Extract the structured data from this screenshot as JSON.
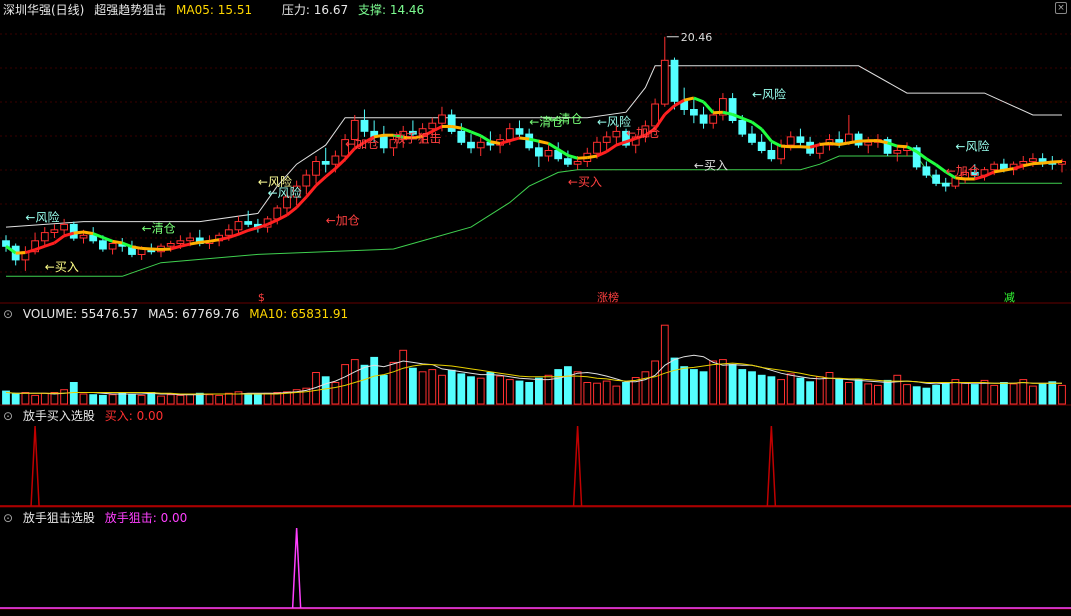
{
  "main_header": {
    "stock": "深圳华强(日线)",
    "indicator": "超强趋势狙击",
    "ma_label": "MA05: 15.51",
    "pressure_label": "压力: 16.67",
    "support_label": "支撑: 14.46"
  },
  "volume_header": {
    "name": "VOLUME: 55476.57",
    "ma5": "MA5: 67769.76",
    "ma10": "MA10: 65831.91"
  },
  "buy_header": {
    "name": "放手买入选股",
    "value": "买入: 0.00"
  },
  "snipe_header": {
    "name": "放手狙击选股",
    "value": "放手狙击: 0.00"
  },
  "colors": {
    "up": "#ff3030",
    "down": "#54ffff",
    "pressure": "#e0e0e0",
    "support": "#3fd04f",
    "buy_signal": "#c00000",
    "snipe_signal": "#ff40ff",
    "ma5": "#e0e0e0",
    "ma10": "#e8d000"
  },
  "chart_data": [
    {
      "type": "candlestick",
      "title": "超强趋势狙击",
      "peak_label": "20.46",
      "candles": [
        [
          13.0,
          13.2,
          12.6,
          12.8
        ],
        [
          12.8,
          12.9,
          12.1,
          12.3
        ],
        [
          12.3,
          12.8,
          11.9,
          12.6
        ],
        [
          12.6,
          13.3,
          12.5,
          13.0
        ],
        [
          13.0,
          13.5,
          12.8,
          13.3
        ],
        [
          13.3,
          13.6,
          13.1,
          13.4
        ],
        [
          13.4,
          13.8,
          13.2,
          13.6
        ],
        [
          13.6,
          13.7,
          13.0,
          13.1
        ],
        [
          13.1,
          13.4,
          12.9,
          13.2
        ],
        [
          13.2,
          13.5,
          12.9,
          13.0
        ],
        [
          13.0,
          13.2,
          12.6,
          12.7
        ],
        [
          12.7,
          13.0,
          12.5,
          12.9
        ],
        [
          12.9,
          13.1,
          12.6,
          12.8
        ],
        [
          12.8,
          13.0,
          12.4,
          12.5
        ],
        [
          12.5,
          12.8,
          12.3,
          12.7
        ],
        [
          12.7,
          12.9,
          12.5,
          12.6
        ],
        [
          12.6,
          12.9,
          12.4,
          12.8
        ],
        [
          12.8,
          13.0,
          12.6,
          12.9
        ],
        [
          12.9,
          13.2,
          12.7,
          13.0
        ],
        [
          13.0,
          13.3,
          12.8,
          13.1
        ],
        [
          13.1,
          13.4,
          12.8,
          12.9
        ],
        [
          12.9,
          13.2,
          12.7,
          13.0
        ],
        [
          13.0,
          13.3,
          12.8,
          13.2
        ],
        [
          13.2,
          13.6,
          13.0,
          13.4
        ],
        [
          13.4,
          13.9,
          13.2,
          13.7
        ],
        [
          13.7,
          14.1,
          13.5,
          13.6
        ],
        [
          13.6,
          13.8,
          13.3,
          13.5
        ],
        [
          13.5,
          13.9,
          13.3,
          13.8
        ],
        [
          13.8,
          14.3,
          13.6,
          14.2
        ],
        [
          14.2,
          14.8,
          14.0,
          14.6
        ],
        [
          14.6,
          15.2,
          14.3,
          15.0
        ],
        [
          15.0,
          15.6,
          14.7,
          15.4
        ],
        [
          15.4,
          16.1,
          15.1,
          15.9
        ],
        [
          15.9,
          16.4,
          15.5,
          15.8
        ],
        [
          15.8,
          16.3,
          15.5,
          16.1
        ],
        [
          16.1,
          16.9,
          15.9,
          16.7
        ],
        [
          16.7,
          17.6,
          16.4,
          17.4
        ],
        [
          17.4,
          17.8,
          16.8,
          17.0
        ],
        [
          17.0,
          17.4,
          16.6,
          16.8
        ],
        [
          16.8,
          17.2,
          16.2,
          16.4
        ],
        [
          16.4,
          16.9,
          16.1,
          16.7
        ],
        [
          16.7,
          17.2,
          16.4,
          17.0
        ],
        [
          17.0,
          17.4,
          16.7,
          16.9
        ],
        [
          16.9,
          17.3,
          16.6,
          17.1
        ],
        [
          17.1,
          17.5,
          16.8,
          17.3
        ],
        [
          17.3,
          17.9,
          17.0,
          17.6
        ],
        [
          17.6,
          17.8,
          16.9,
          17.0
        ],
        [
          17.0,
          17.3,
          16.5,
          16.6
        ],
        [
          16.6,
          16.9,
          16.2,
          16.4
        ],
        [
          16.4,
          16.8,
          16.1,
          16.6
        ],
        [
          16.6,
          17.0,
          16.3,
          16.5
        ],
        [
          16.5,
          16.9,
          16.2,
          16.7
        ],
        [
          16.7,
          17.3,
          16.5,
          17.1
        ],
        [
          17.1,
          17.4,
          16.8,
          16.9
        ],
        [
          16.9,
          17.1,
          16.3,
          16.4
        ],
        [
          16.4,
          16.7,
          15.7,
          16.1
        ],
        [
          16.1,
          16.5,
          15.9,
          16.3
        ],
        [
          16.3,
          16.6,
          15.9,
          16.0
        ],
        [
          16.0,
          16.3,
          15.7,
          15.8
        ],
        [
          15.8,
          16.1,
          15.6,
          15.9
        ],
        [
          15.9,
          16.4,
          15.7,
          16.2
        ],
        [
          16.2,
          16.8,
          16.0,
          16.6
        ],
        [
          16.6,
          17.0,
          16.3,
          16.8
        ],
        [
          16.8,
          17.2,
          16.5,
          17.0
        ],
        [
          17.0,
          17.1,
          16.4,
          16.5
        ],
        [
          16.5,
          16.9,
          16.2,
          16.8
        ],
        [
          16.8,
          17.4,
          16.6,
          17.2
        ],
        [
          17.2,
          18.2,
          17.0,
          18.0
        ],
        [
          18.0,
          20.46,
          17.9,
          19.6
        ],
        [
          19.6,
          19.7,
          17.8,
          18.1
        ],
        [
          18.1,
          18.6,
          17.6,
          17.8
        ],
        [
          17.8,
          18.2,
          17.3,
          17.6
        ],
        [
          17.6,
          17.9,
          17.1,
          17.3
        ],
        [
          17.3,
          17.8,
          17.1,
          17.6
        ],
        [
          17.6,
          18.4,
          17.4,
          18.2
        ],
        [
          18.2,
          18.4,
          17.3,
          17.4
        ],
        [
          17.4,
          17.6,
          16.8,
          16.9
        ],
        [
          16.9,
          17.2,
          16.5,
          16.6
        ],
        [
          16.6,
          16.9,
          16.2,
          16.3
        ],
        [
          16.3,
          16.6,
          15.9,
          16.0
        ],
        [
          16.0,
          16.7,
          15.8,
          16.5
        ],
        [
          16.5,
          17.0,
          16.3,
          16.8
        ],
        [
          16.8,
          17.1,
          16.4,
          16.6
        ],
        [
          16.6,
          16.8,
          16.1,
          16.2
        ],
        [
          16.2,
          16.6,
          16.0,
          16.5
        ],
        [
          16.5,
          16.9,
          16.3,
          16.7
        ],
        [
          16.7,
          17.0,
          16.4,
          16.6
        ],
        [
          16.6,
          17.6,
          16.5,
          16.9
        ],
        [
          16.9,
          17.0,
          16.4,
          16.5
        ],
        [
          16.5,
          16.8,
          16.2,
          16.6
        ],
        [
          16.6,
          16.9,
          16.4,
          16.7
        ],
        [
          16.7,
          16.8,
          16.1,
          16.2
        ],
        [
          16.2,
          16.5,
          15.9,
          16.3
        ],
        [
          16.3,
          16.6,
          16.1,
          16.4
        ],
        [
          16.4,
          16.5,
          15.6,
          15.7
        ],
        [
          15.7,
          15.9,
          15.3,
          15.4
        ],
        [
          15.4,
          15.6,
          15.0,
          15.1
        ],
        [
          15.1,
          15.3,
          14.8,
          15.0
        ],
        [
          15.0,
          15.4,
          14.9,
          15.3
        ],
        [
          15.3,
          15.6,
          15.1,
          15.5
        ],
        [
          15.5,
          15.8,
          15.3,
          15.4
        ],
        [
          15.4,
          15.7,
          15.2,
          15.6
        ],
        [
          15.6,
          15.9,
          15.4,
          15.8
        ],
        [
          15.8,
          16.0,
          15.5,
          15.6
        ],
        [
          15.6,
          15.9,
          15.4,
          15.8
        ],
        [
          15.8,
          16.1,
          15.6,
          15.9
        ],
        [
          15.9,
          16.2,
          15.7,
          16.0
        ],
        [
          16.0,
          16.2,
          15.7,
          15.9
        ],
        [
          15.9,
          16.1,
          15.6,
          15.8
        ],
        [
          15.8,
          16.0,
          15.5,
          15.9
        ]
      ],
      "pressure": [
        [
          0,
          13.5
        ],
        [
          8,
          13.7
        ],
        [
          20,
          13.7
        ],
        [
          26,
          14.0
        ],
        [
          28,
          15.0
        ],
        [
          30,
          15.8
        ],
        [
          33,
          16.5
        ],
        [
          35,
          17.5
        ],
        [
          45,
          17.5
        ],
        [
          60,
          17.5
        ],
        [
          64,
          17.7
        ],
        [
          66,
          18.6
        ],
        [
          67,
          19.4
        ],
        [
          88,
          19.4
        ],
        [
          93,
          18.4
        ],
        [
          101,
          18.4
        ],
        [
          106,
          17.6
        ],
        [
          109,
          17.6
        ]
      ],
      "support": [
        [
          0,
          11.7
        ],
        [
          12,
          11.7
        ],
        [
          16,
          12.2
        ],
        [
          26,
          12.5
        ],
        [
          40,
          12.7
        ],
        [
          44,
          13.1
        ],
        [
          48,
          13.5
        ],
        [
          52,
          14.4
        ],
        [
          54,
          15.0
        ],
        [
          57,
          15.5
        ],
        [
          59,
          15.6
        ],
        [
          75,
          15.6
        ],
        [
          82,
          15.6
        ],
        [
          84,
          15.8
        ],
        [
          86,
          16.1
        ],
        [
          94,
          16.1
        ],
        [
          96,
          15.1
        ],
        [
          109,
          15.1
        ]
      ],
      "labels": [
        "←风险",
        "←买入",
        "←加仓",
        "←清仓",
        "←风险",
        "←加仓",
        "←风险",
        "放手狙击",
        "←清仓",
        "←加仓",
        "←清仓",
        "←买入",
        "←风险",
        "←风险",
        "←买入",
        "←加仓",
        "←风险"
      ],
      "bottom_markers": [
        "$",
        "涨榜",
        "减"
      ]
    },
    {
      "type": "bar",
      "title": "VOLUME",
      "values": [
        18,
        14,
        16,
        12,
        15,
        16,
        20,
        30,
        14,
        13,
        12,
        13,
        15,
        14,
        12,
        16,
        11,
        13,
        12,
        14,
        15,
        13,
        12,
        15,
        17,
        14,
        13,
        15,
        16,
        17,
        20,
        22,
        44,
        38,
        30,
        55,
        62,
        54,
        65,
        40,
        58,
        75,
        50,
        45,
        48,
        40,
        47,
        42,
        38,
        36,
        44,
        39,
        34,
        32,
        30,
        36,
        40,
        48,
        52,
        45,
        30,
        29,
        32,
        25,
        30,
        37,
        45,
        60,
        110,
        64,
        52,
        48,
        45,
        60,
        62,
        55,
        48,
        45,
        40,
        38,
        34,
        42,
        36,
        31,
        38,
        44,
        35,
        30,
        34,
        28,
        26,
        33,
        40,
        27,
        24,
        22,
        26,
        30,
        34,
        29,
        27,
        33,
        26,
        30,
        28,
        34,
        25,
        28,
        31,
        26
      ],
      "ma5": [
        16,
        15,
        15,
        15,
        15,
        14,
        15,
        16,
        16,
        16,
        15,
        14,
        14,
        14,
        14,
        15,
        14,
        14,
        13,
        13,
        13,
        14,
        14,
        14,
        14,
        15,
        15,
        15,
        15,
        16,
        17,
        19,
        23,
        28,
        32,
        38,
        45,
        51,
        54,
        52,
        56,
        60,
        58,
        56,
        55,
        49,
        47,
        45,
        43,
        41,
        41,
        40,
        38,
        36,
        35,
        34,
        34,
        36,
        39,
        43,
        44,
        42,
        39,
        35,
        31,
        31,
        34,
        40,
        54,
        62,
        66,
        68,
        66,
        58,
        54,
        55,
        54,
        54,
        51,
        47,
        43,
        40,
        38,
        36,
        35,
        36,
        35,
        34,
        33,
        32,
        31,
        30,
        31,
        32,
        31,
        29,
        28,
        29,
        30,
        29,
        29,
        29,
        29,
        29,
        29,
        30,
        29,
        29,
        29,
        29
      ],
      "ma10": [
        16,
        15,
        15,
        15,
        15,
        15,
        15,
        16,
        16,
        16,
        16,
        16,
        16,
        16,
        16,
        16,
        15,
        15,
        14,
        14,
        14,
        14,
        14,
        14,
        14,
        14,
        14,
        14,
        14,
        15,
        16,
        17,
        19,
        21,
        23,
        26,
        30,
        34,
        39,
        41,
        45,
        50,
        53,
        55,
        55,
        54,
        53,
        51,
        49,
        47,
        45,
        43,
        41,
        39,
        38,
        38,
        38,
        38,
        39,
        39,
        38,
        36,
        35,
        33,
        32,
        33,
        36,
        38,
        43,
        47,
        50,
        51,
        53,
        55,
        56,
        57,
        56,
        54,
        51,
        49,
        47,
        45,
        43,
        40,
        38,
        36,
        36,
        35,
        35,
        34,
        33,
        32,
        32,
        32,
        31,
        30,
        30,
        30,
        30,
        30,
        30,
        30,
        29,
        29,
        29,
        30,
        29,
        29,
        29,
        29
      ],
      "ylim": [
        0,
        120
      ]
    },
    {
      "type": "line",
      "title": "放手买入选股",
      "name": "买入",
      "x": [
        0,
        1,
        2,
        3,
        4,
        5,
        6,
        7,
        8,
        9,
        10
      ],
      "signals_at": [
        3,
        59,
        79
      ]
    },
    {
      "type": "line",
      "title": "放手狙击选股",
      "name": "放手狙击",
      "signals_at": [
        30
      ]
    }
  ]
}
